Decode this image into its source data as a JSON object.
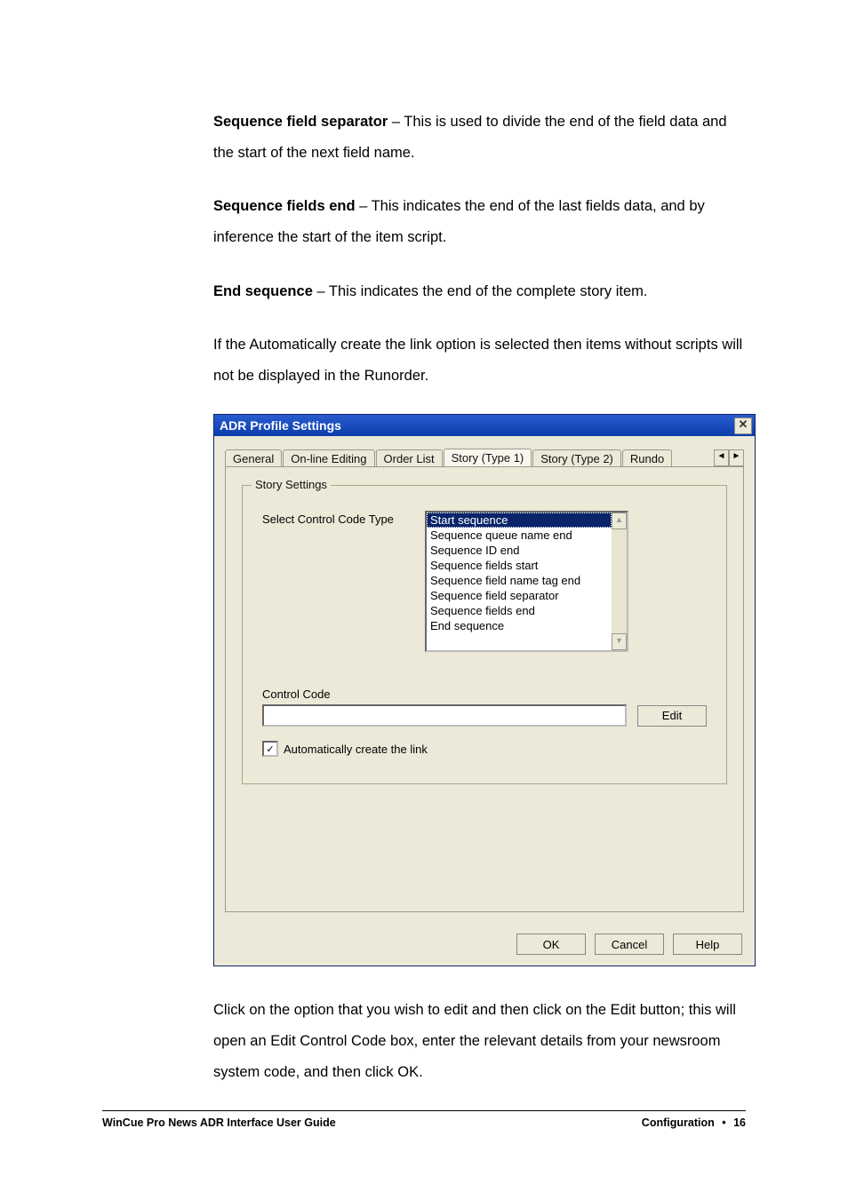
{
  "paragraphs": {
    "p1_bold": "Sequence field separator",
    "p1_rest": " – This is used to divide the end of the field data and the start of the next field name.",
    "p2_bold": "Sequence fields end",
    "p2_rest": " – This indicates the end of the last fields data, and by inference the start of the item script.",
    "p3_bold": "End sequence",
    "p3_rest": " – This indicates the end of the complete story item.",
    "p4": "If the Automatically create the link option is selected then items without scripts will not be displayed in the Runorder.",
    "p5": "Click on the option that you wish to edit and then click on the Edit button; this will open an Edit Control Code box, enter the relevant details from your newsroom system code, and then click OK."
  },
  "dialog": {
    "title": "ADR Profile Settings",
    "tabs": [
      "General",
      "On-line Editing",
      "Order List",
      "Story (Type 1)",
      "Story (Type 2)",
      "Rundo"
    ],
    "active_tab_index": 3,
    "groupbox_title": "Story Settings",
    "select_label": "Select Control Code Type",
    "list_items": [
      "Start sequence",
      "Sequence queue name end",
      "Sequence ID end",
      "Sequence fields start",
      "Sequence field name tag end",
      "Sequence field separator",
      "Sequence fields end",
      "End sequence"
    ],
    "selected_list_index": 0,
    "control_code_label": "Control Code",
    "control_code_value": "",
    "edit_button": "Edit",
    "checkbox_label": "Automatically create the link",
    "checkbox_checked": true,
    "ok": "OK",
    "cancel": "Cancel",
    "help": "Help",
    "scroll_left": "◄",
    "scroll_right": "►",
    "scroll_up": "▲",
    "scroll_down": "▼",
    "close_glyph": "✕"
  },
  "footer": {
    "left": "WinCue Pro News ADR Interface User Guide",
    "right_label": "Configuration",
    "bullet": "•",
    "page": "16"
  }
}
